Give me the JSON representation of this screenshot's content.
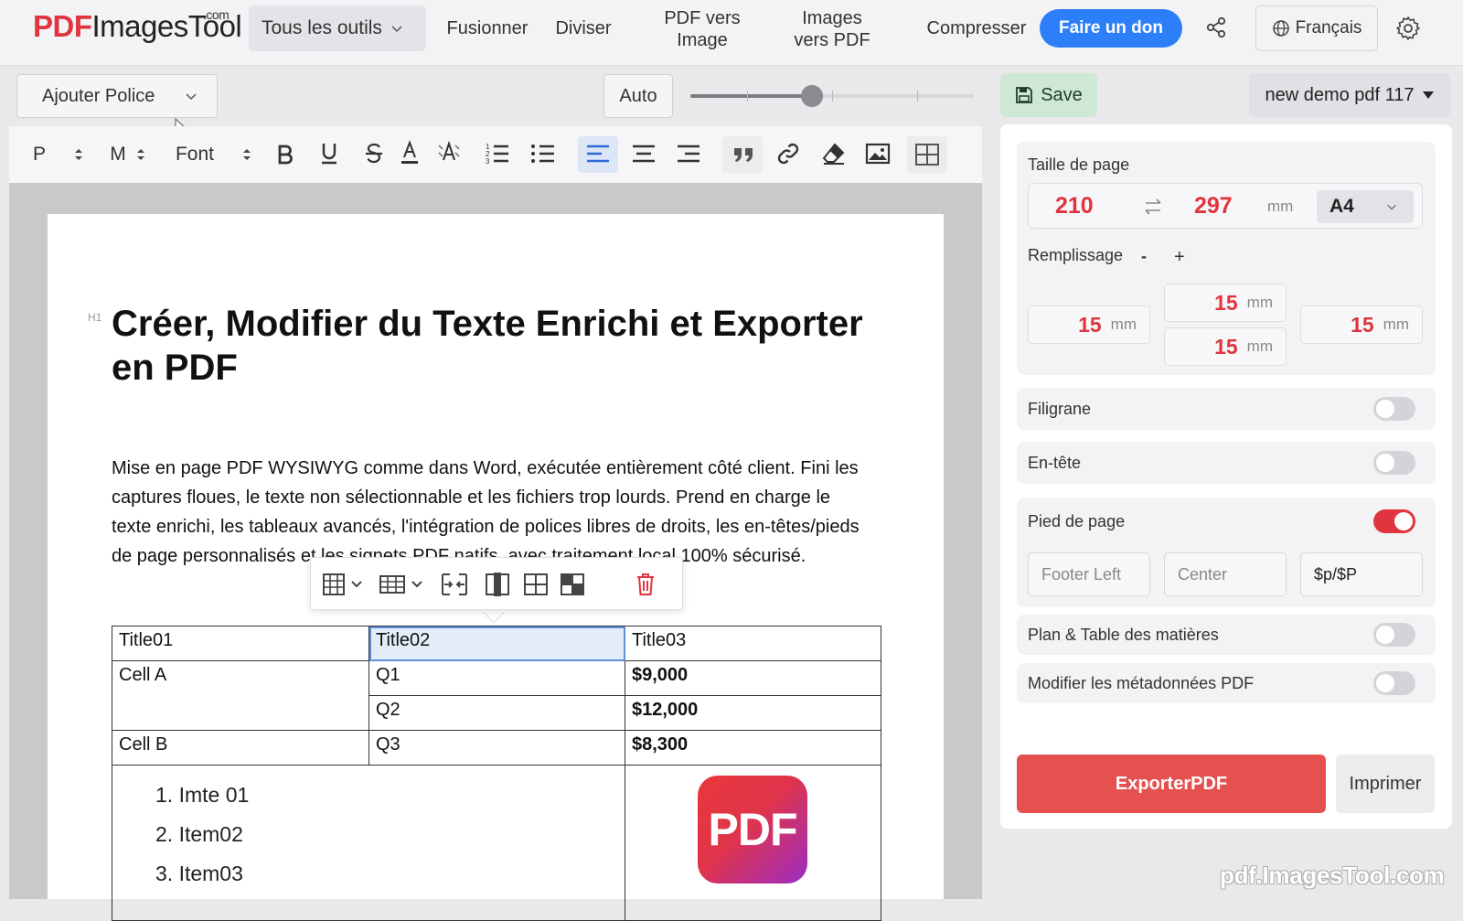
{
  "header": {
    "logo_pdf": "PDF",
    "logo_rest": "ImagesTool",
    "logo_com": ".com",
    "tools_label": "Tous les outils",
    "nav": [
      "Fusionner",
      "Diviser",
      "PDF vers Image",
      "Images vers PDF",
      "Compresser"
    ],
    "donate_label": "Faire un don",
    "language": "Français",
    "share_icon": "share-icon",
    "settings_icon": "gear-icon"
  },
  "fontbar": {
    "add_font_label": "Ajouter Police",
    "auto_label": "Auto",
    "zoom_slider_value": 0.43
  },
  "toolbar": {
    "paragraph": "P",
    "size": "M",
    "font": "Font",
    "icons": [
      "bold-icon",
      "underline-icon",
      "strikethrough-icon",
      "text-color-icon",
      "highlight-icon",
      "ordered-list-icon",
      "bullet-list-icon",
      "align-left-icon",
      "align-center-icon",
      "align-right-icon",
      "quote-icon",
      "link-icon",
      "eraser-icon",
      "image-icon",
      "table-icon"
    ]
  },
  "document": {
    "heading_tag": "H1",
    "title": "Créer, Modifier du Texte Enrichi et Exporter en PDF",
    "paragraph": "Mise en page PDF WYSIWYG comme dans Word, exécutée entièrement côté client. Fini les captures floues, le texte non sélectionnable et les fichiers trop lourds. Prend en charge le texte enrichi, les tableaux avancés, l'intégration de polices libres de droits, les en-têtes/pieds de page personnalisés et les signets PDF natifs, avec traitement local 100% sécurisé.",
    "table": {
      "header": [
        "Title01",
        "Title02",
        "Title03"
      ],
      "rows": [
        [
          "Cell A",
          "Q1",
          "$9,000"
        ],
        [
          "",
          "Q2",
          "$12,000"
        ],
        [
          "Cell B",
          "Q3",
          "$8,300"
        ]
      ]
    },
    "list_items": [
      "1. Imte 01",
      "2. Item02",
      "3. Item03"
    ],
    "image_label": "PDF"
  },
  "sidebar": {
    "save_label": "Save",
    "doc_name": "new demo pdf 117",
    "page_size_label": "Taille de page",
    "width": "210",
    "height": "297",
    "unit": "mm",
    "format": "A4",
    "padding_label": "Remplissage",
    "padding_minus": "-",
    "padding_plus": "+",
    "padding": {
      "top": "15",
      "left": "15",
      "bottom": "15",
      "right": "15"
    },
    "watermark_label": "Filigrane",
    "watermark_on": false,
    "header_label": "En-tête",
    "header_on": false,
    "footer_label": "Pied de page",
    "footer_on": true,
    "footer_left_placeholder": "Footer Left",
    "footer_center_placeholder": "Center",
    "footer_right_value": "$p/$P",
    "toc_label": "Plan & Table des matières",
    "toc_on": false,
    "metadata_label": "Modifier les métadonnées PDF",
    "metadata_on": false,
    "export_label": "ExporterPDF",
    "print_label": "Imprimer"
  },
  "watermark_text": "pdf.ImagesTool.com",
  "colors": {
    "accent_red": "#e0343e",
    "donate_blue": "#2d7ff9",
    "save_green": "#cfe7d5"
  }
}
